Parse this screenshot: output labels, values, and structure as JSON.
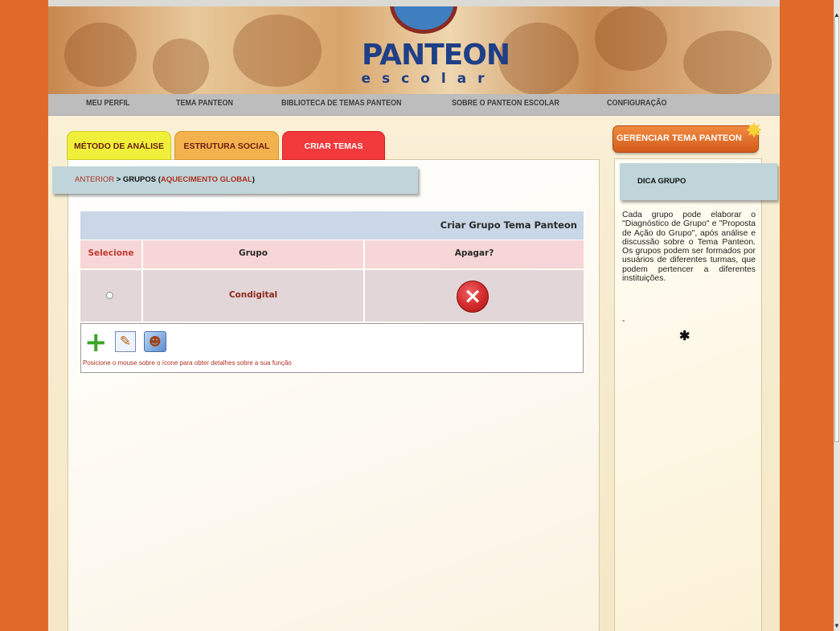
{
  "header": {
    "logo_title": "PANTEON",
    "logo_subtitle": "escolar"
  },
  "nav": {
    "items": [
      "MEU PERFIL",
      "TEMA PANTEON",
      "BIBLIOTECA DE TEMAS PANTEON",
      "SOBRE O PANTEON ESCOLAR",
      "CONFIGURAÇÃO"
    ]
  },
  "tabs": [
    "MÉTODO DE ANÁLISE",
    "ESTRUTURA SOCIAL",
    "CRIAR TEMAS"
  ],
  "breadcrumb": {
    "back": "ANTERIOR",
    "sep": " > ",
    "current": "GRUPOS",
    "open": " (",
    "topic": "AQUECIMENTO GLOBAL",
    "close": ")"
  },
  "table": {
    "title": "Criar Grupo Tema Panteon",
    "columns": [
      "Selecione",
      "Grupo",
      "Apagar?"
    ],
    "rows": [
      {
        "group": "Condigital"
      }
    ]
  },
  "toolbar": {
    "icons": [
      "add-icon",
      "edit-icon",
      "group-icon"
    ],
    "hint": "Posicione o mouse sobre o ícone para obter detalhes sobre a sua função"
  },
  "sidebar": {
    "manage_label": "GERENCIAR TEMA PANTEON",
    "dica_title": "DICA GRUPO",
    "dica_text": "Cada grupo pode elaborar o \"Diagnóstico de Grupo\" e \"Proposta de Ação do Grupo\", após análise e discussão sobre o Tema Panteon. Os grupos podem ser formados por usuários de diferentes turmas, que podem pertencer a diferentes instituições.",
    "dash": "-",
    "asterisk": "✱"
  },
  "colors": {
    "background": "#e06a2a",
    "tab_metodo": "#f0f03a",
    "tab_estrutura": "#f2b24e",
    "tab_criar": "#f2393c",
    "delete": "#d12a2a",
    "link": "#b03020"
  }
}
